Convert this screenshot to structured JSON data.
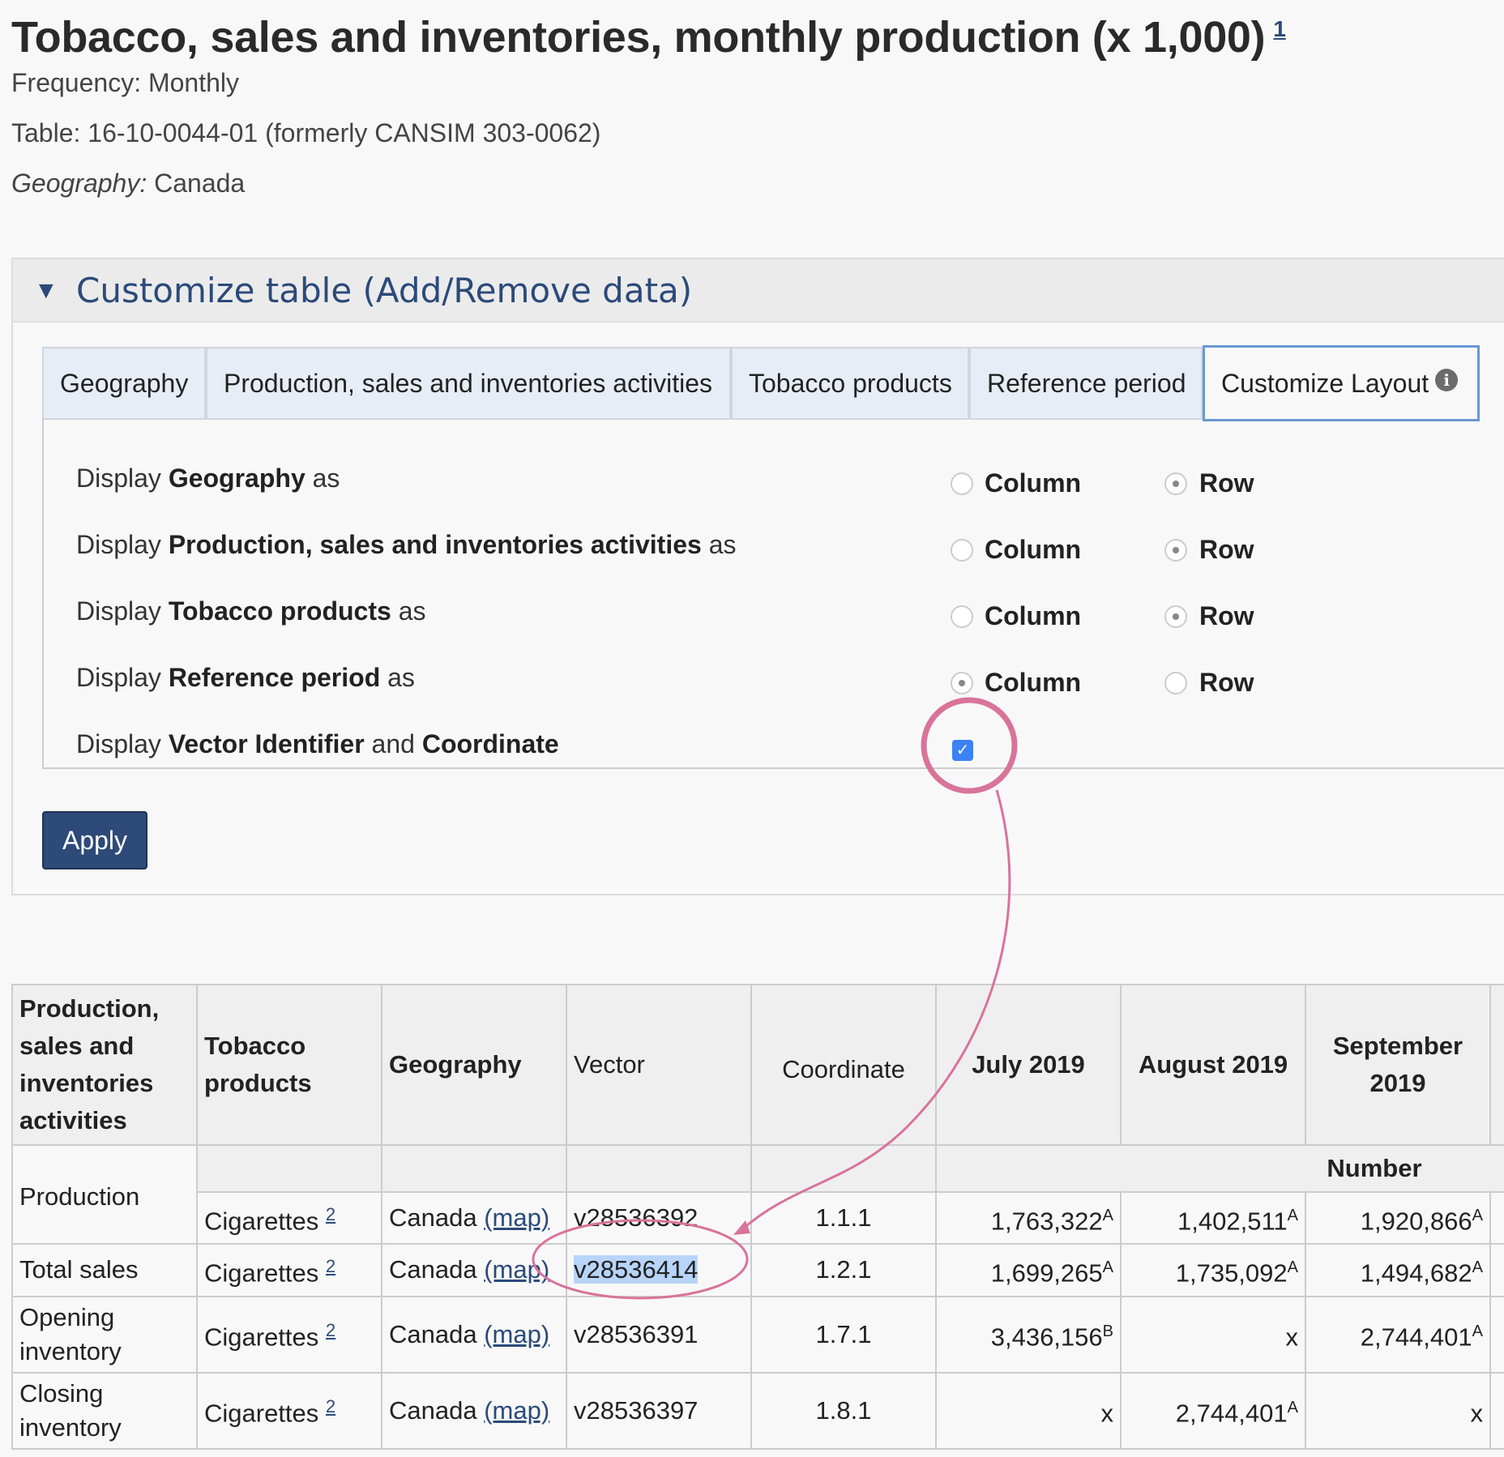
{
  "page": {
    "title": "Tobacco, sales and inventories, monthly production (x 1,000)",
    "title_footnote": "1",
    "frequency_label": "Frequency:",
    "frequency_value": "Monthly",
    "table_label": "Table:",
    "table_value": "16-10-0044-01 (formerly CANSIM 303-0062)",
    "geography_label": "Geography:",
    "geography_value": "Canada"
  },
  "customize": {
    "heading": "Customize table (Add/Remove data)",
    "tabs": [
      "Geography",
      "Production, sales and inventories activities",
      "Tobacco products",
      "Reference period",
      "Customize Layout"
    ],
    "active_tab": "Customize Layout",
    "info_icon": "i",
    "rows": [
      {
        "prefix": "Display",
        "name": "Geography",
        "suffix": "as",
        "selected": "Row"
      },
      {
        "prefix": "Display",
        "name": "Production, sales and inventories activities",
        "suffix": "as",
        "selected": "Row"
      },
      {
        "prefix": "Display",
        "name": "Tobacco products",
        "suffix": "as",
        "selected": "Row"
      },
      {
        "prefix": "Display",
        "name": "Reference period",
        "suffix": "as",
        "selected": "Column"
      }
    ],
    "option_column": "Column",
    "option_row": "Row",
    "vector_row": {
      "prefix": "Display",
      "name1": "Vector Identifier",
      "mid": "and",
      "name2": "Coordinate",
      "checked": true
    },
    "apply_label": "Apply"
  },
  "table": {
    "headers": [
      "Production, sales and inventories activities",
      "Tobacco products",
      "Geography",
      "Vector",
      "Coordinate",
      "July 2019",
      "August 2019",
      "September 2019"
    ],
    "units_label": "Number",
    "map_label": "(map)",
    "rows": [
      {
        "activity": "Production",
        "product": "Cigarettes",
        "fn": "2",
        "geo": "Canada",
        "vector": "v28536392",
        "coord": "1.1.1",
        "jul": "1,763,322",
        "jul_q": "A",
        "aug": "1,402,511",
        "aug_q": "A",
        "sep": "1,920,866",
        "sep_q": "A"
      },
      {
        "activity": "Total sales",
        "product": "Cigarettes",
        "fn": "2",
        "geo": "Canada",
        "vector": "v28536414",
        "coord": "1.2.1",
        "jul": "1,699,265",
        "jul_q": "A",
        "aug": "1,735,092",
        "aug_q": "A",
        "sep": "1,494,682",
        "sep_q": "A"
      },
      {
        "activity": "Opening inventory",
        "product": "Cigarettes",
        "fn": "2",
        "geo": "Canada",
        "vector": "v28536391",
        "coord": "1.7.1",
        "jul": "3,436,156",
        "jul_q": "B",
        "aug": "x",
        "aug_q": "",
        "sep": "2,744,401",
        "sep_q": "A"
      },
      {
        "activity": "Closing inventory",
        "product": "Cigarettes",
        "fn": "2",
        "geo": "Canada",
        "vector": "v28536397",
        "coord": "1.8.1",
        "jul": "x",
        "jul_q": "",
        "aug": "2,744,401",
        "aug_q": "A",
        "sep": "x",
        "sep_q": ""
      }
    ]
  },
  "colors": {
    "accent": "#2b4a7a",
    "annotation": "#d9739a",
    "checkbox": "#3b82f6",
    "highlight": "#b8d4f8"
  }
}
